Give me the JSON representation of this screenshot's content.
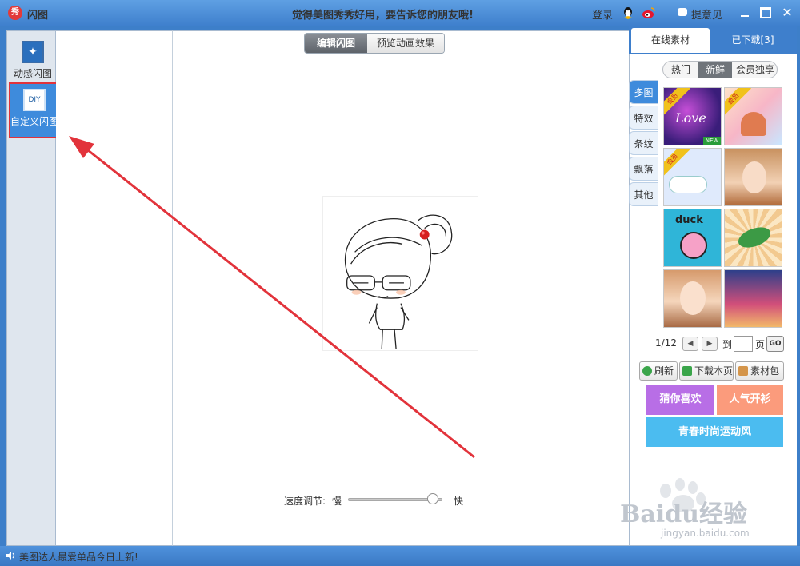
{
  "window": {
    "logo_glyph": "秀",
    "title": "闪图",
    "slogan": "觉得美图秀秀好用，要告诉您的朋友哦!",
    "login_label": "登录",
    "feedback_label": "提意见",
    "close_glyph": "✕"
  },
  "left_nav": {
    "items": [
      {
        "label": "动感闪图",
        "icon": "sparkle-frame-icon",
        "icon_glyph": "✦"
      },
      {
        "label": "自定义闪图",
        "icon": "diy-frame-icon",
        "icon_glyph": "DIY"
      }
    ],
    "selected_index": 1,
    "highlight_color": "#e2333b"
  },
  "canvas": {
    "tabs": [
      "编辑闪图",
      "预览动画效果"
    ],
    "active_tab": 0,
    "speed": {
      "label": "速度调节:",
      "slow_label": "慢",
      "fast_label": "快",
      "value_fraction": 0.9
    }
  },
  "material_panel": {
    "tabs": [
      "在线素材",
      "已下载[3]"
    ],
    "active_tab": 0,
    "filters": [
      "热门",
      "新鲜",
      "会员独享"
    ],
    "active_filter": 1,
    "categories": [
      "多图",
      "特效",
      "条纹",
      "飘落",
      "其他"
    ],
    "active_category": 0,
    "thumbnails": [
      {
        "name": "love-galaxy",
        "vip": true,
        "new": true,
        "vip_label": "会员",
        "new_label": "NEW",
        "text": "Love"
      },
      {
        "name": "cupcake-party",
        "vip": true,
        "vip_label": "会员"
      },
      {
        "name": "cloud-rain",
        "vip": true,
        "vip_label": "会员"
      },
      {
        "name": "girl-portrait-1"
      },
      {
        "name": "duck-cartoon",
        "text": "duck"
      },
      {
        "name": "green-leaf-sunburst"
      },
      {
        "name": "girl-portrait-2"
      },
      {
        "name": "girl-group-photo"
      }
    ],
    "pager": {
      "current": "1/12",
      "goto_label": "到",
      "page_unit": "页",
      "go_label": "GO",
      "prev_glyph": "◀",
      "next_glyph": "▶"
    },
    "actions": [
      "刷新",
      "下载本页",
      "素材包"
    ],
    "promos": [
      "猜你喜欢",
      "人气开衫",
      "青春时尚运动风"
    ]
  },
  "status": {
    "message": "美图达人最爱单品今日上新!"
  },
  "watermark": {
    "brand": "Baidu经验",
    "url": "jingyan.baidu.com"
  },
  "colors": {
    "titlebar": "#3e7fcc",
    "accent": "#3e8bdc",
    "arrow": "#e2333b"
  }
}
